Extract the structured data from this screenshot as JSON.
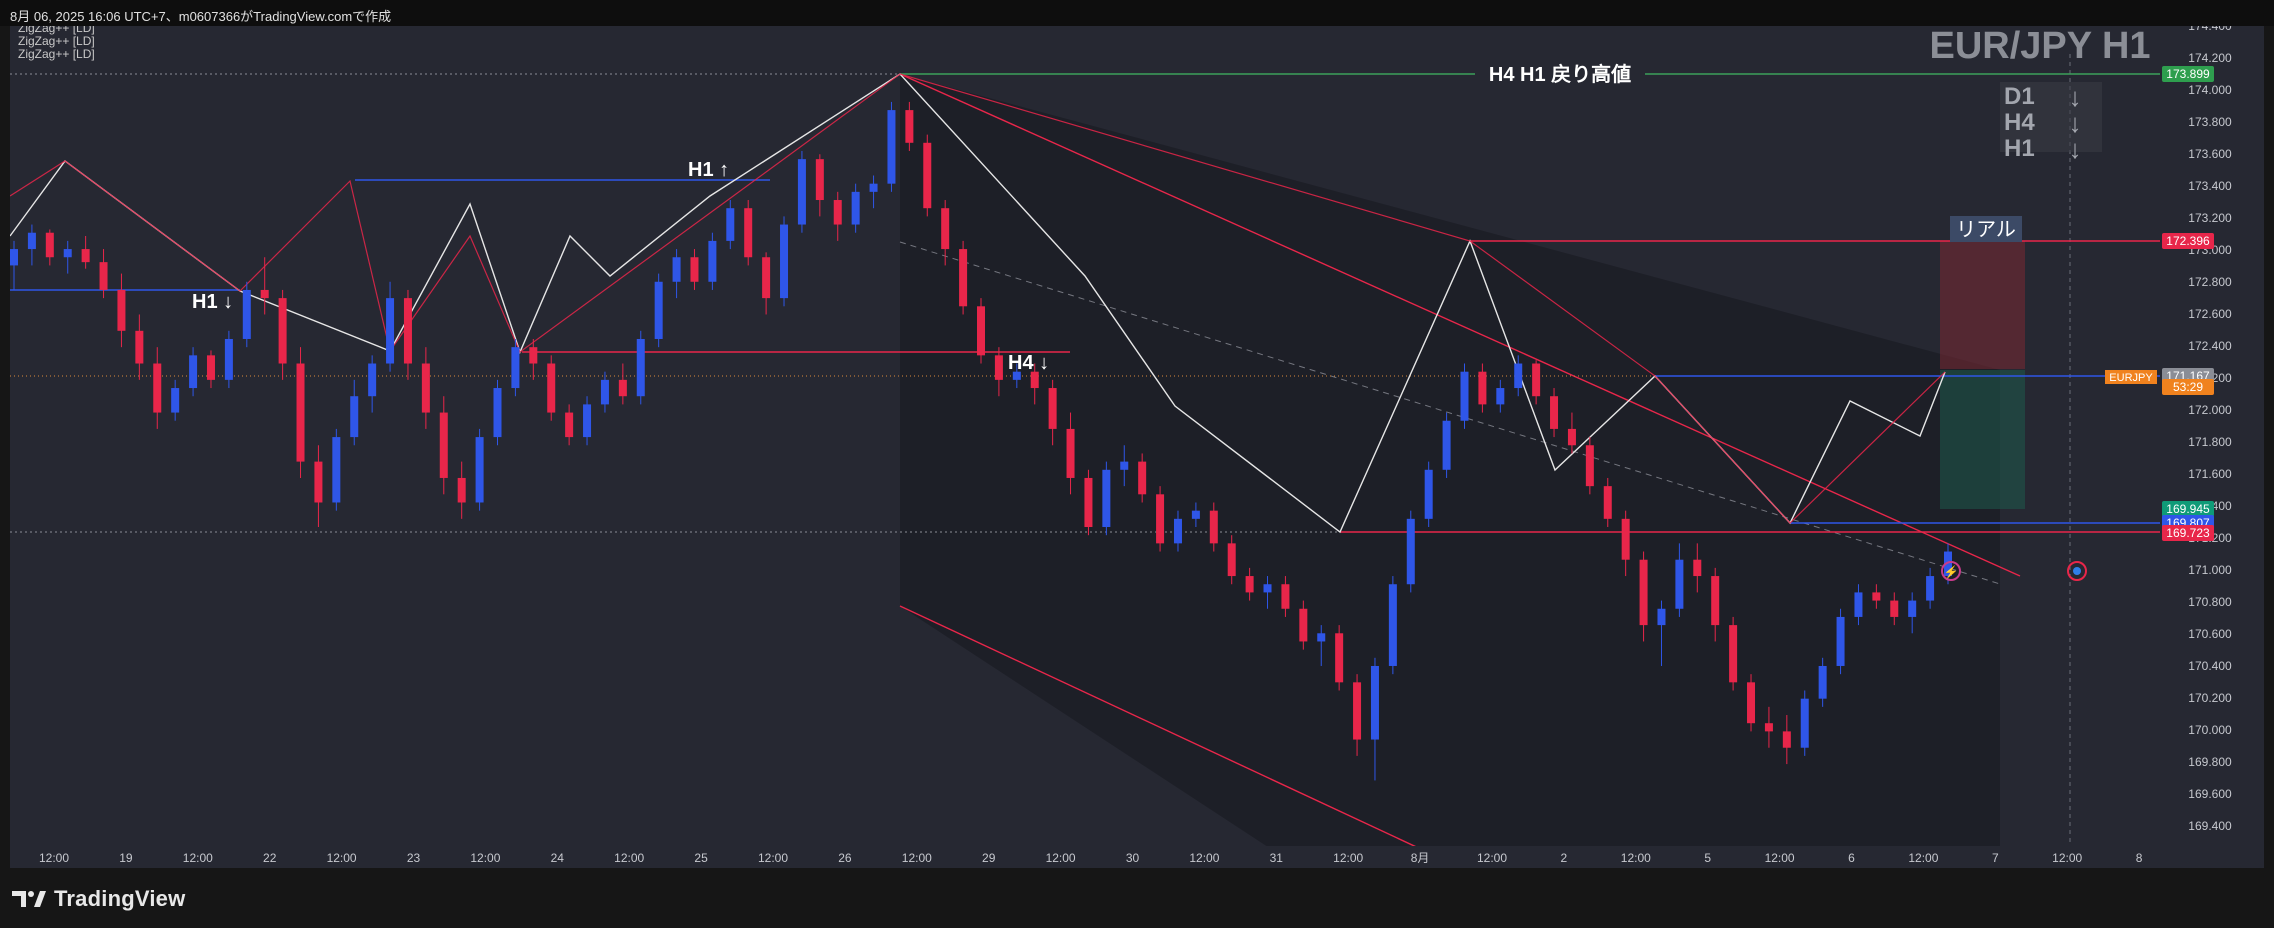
{
  "header": {
    "caption": "8月 06, 2025 16:06 UTC+7、m0607366がTradingView.comで作成"
  },
  "indicators": [
    "ZigZag++ [LD]",
    "ZigZag++ [LD]",
    "ZigZag++ [LD]"
  ],
  "watermark": {
    "title": "EUR/JPY H1"
  },
  "trend_panel": [
    {
      "tf": "D1",
      "arrow": "↓"
    },
    {
      "tf": "H4",
      "arrow": "↓"
    },
    {
      "tf": "H1",
      "arrow": "↓"
    }
  ],
  "annotations": {
    "resistance_label": "H4 H1 戻り高値",
    "real_label": "リアル",
    "h1_down": "H1 ↓",
    "h1_up": "H1 ↑",
    "h4_down": "H4 ↓"
  },
  "price_axis": {
    "ticks": [
      "174.400",
      "174.200",
      "174.000",
      "173.800",
      "173.600",
      "173.400",
      "173.200",
      "173.000",
      "172.800",
      "172.600",
      "172.400",
      "172.200",
      "172.000",
      "171.800",
      "171.600",
      "171.400",
      "171.200",
      "171.000",
      "170.800",
      "170.600",
      "170.400",
      "170.200",
      "170.000",
      "169.800",
      "169.600",
      "169.400"
    ],
    "badges": [
      {
        "text": "173.899",
        "color": "#2e9e4e"
      },
      {
        "text": "172.396",
        "color": "#e8264a"
      },
      {
        "text": "171.167",
        "color": "#8a8d96"
      },
      {
        "text": "53:29",
        "color": "#f0821e"
      },
      {
        "text": "169.945",
        "color": "#0f9b78"
      },
      {
        "text": "169.807",
        "color": "#2f56e8"
      },
      {
        "text": "169.723",
        "color": "#e8264a"
      }
    ],
    "symbol_badge": "EURJPY"
  },
  "time_axis": [
    "12:00",
    "19",
    "12:00",
    "22",
    "12:00",
    "23",
    "12:00",
    "24",
    "12:00",
    "25",
    "12:00",
    "26",
    "12:00",
    "29",
    "12:00",
    "30",
    "12:00",
    "31",
    "12:00",
    "8月",
    "12:00",
    "2",
    "12:00",
    "5",
    "12:00",
    "6",
    "12:00",
    "7",
    "12:00",
    "8"
  ],
  "colors": {
    "bull": "#2f56e8",
    "bear": "#e8264a",
    "background": "#262832",
    "channel": "#e8264a",
    "resistance": "#3ca05a",
    "zigzag": "#e6e6e6"
  },
  "brand": {
    "name": "TradingView"
  },
  "chart_data": {
    "type": "candlestick",
    "title": "EUR/JPY H1",
    "ylim": [
      169.3,
      174.45
    ],
    "current_price": 171.167,
    "levels": {
      "resistance": 173.899,
      "stop_loss": 172.396,
      "take_profit": 169.945,
      "support_1": 169.807,
      "support_2": 169.723
    },
    "candles": [
      [
        172.9,
        173.05,
        172.75,
        173.0
      ],
      [
        173.0,
        173.15,
        172.9,
        173.1
      ],
      [
        173.1,
        173.12,
        172.9,
        172.95
      ],
      [
        172.95,
        173.05,
        172.85,
        173.0
      ],
      [
        173.0,
        173.08,
        172.88,
        172.92
      ],
      [
        172.92,
        173.0,
        172.7,
        172.75
      ],
      [
        172.75,
        172.85,
        172.4,
        172.5
      ],
      [
        172.5,
        172.6,
        172.2,
        172.3
      ],
      [
        172.3,
        172.4,
        171.9,
        172.0
      ],
      [
        172.0,
        172.2,
        171.95,
        172.15
      ],
      [
        172.15,
        172.4,
        172.1,
        172.35
      ],
      [
        172.35,
        172.38,
        172.15,
        172.2
      ],
      [
        172.2,
        172.5,
        172.15,
        172.45
      ],
      [
        172.45,
        172.8,
        172.4,
        172.75
      ],
      [
        172.75,
        172.95,
        172.6,
        172.7
      ],
      [
        172.7,
        172.75,
        172.2,
        172.3
      ],
      [
        172.3,
        172.4,
        171.6,
        171.7
      ],
      [
        171.7,
        171.8,
        171.3,
        171.45
      ],
      [
        171.45,
        171.9,
        171.4,
        171.85
      ],
      [
        171.85,
        172.2,
        171.8,
        172.1
      ],
      [
        172.1,
        172.35,
        172.0,
        172.3
      ],
      [
        172.3,
        172.8,
        172.25,
        172.7
      ],
      [
        172.7,
        172.75,
        172.2,
        172.3
      ],
      [
        172.3,
        172.4,
        171.9,
        172.0
      ],
      [
        172.0,
        172.1,
        171.5,
        171.6
      ],
      [
        171.6,
        171.7,
        171.35,
        171.45
      ],
      [
        171.45,
        171.9,
        171.4,
        171.85
      ],
      [
        171.85,
        172.2,
        171.8,
        172.15
      ],
      [
        172.15,
        172.45,
        172.1,
        172.4
      ],
      [
        172.4,
        172.45,
        172.2,
        172.3
      ],
      [
        172.3,
        172.35,
        171.95,
        172.0
      ],
      [
        172.0,
        172.05,
        171.8,
        171.85
      ],
      [
        171.85,
        172.1,
        171.8,
        172.05
      ],
      [
        172.05,
        172.25,
        172.0,
        172.2
      ],
      [
        172.2,
        172.3,
        172.05,
        172.1
      ],
      [
        172.1,
        172.5,
        172.05,
        172.45
      ],
      [
        172.45,
        172.85,
        172.4,
        172.8
      ],
      [
        172.8,
        173.0,
        172.7,
        172.95
      ],
      [
        172.95,
        173.0,
        172.75,
        172.8
      ],
      [
        172.8,
        173.1,
        172.75,
        173.05
      ],
      [
        173.05,
        173.3,
        173.0,
        173.25
      ],
      [
        173.25,
        173.3,
        172.9,
        172.95
      ],
      [
        172.95,
        172.98,
        172.6,
        172.7
      ],
      [
        172.7,
        173.2,
        172.65,
        173.15
      ],
      [
        173.15,
        173.6,
        173.1,
        173.55
      ],
      [
        173.55,
        173.58,
        173.2,
        173.3
      ],
      [
        173.3,
        173.35,
        173.05,
        173.15
      ],
      [
        173.15,
        173.4,
        173.1,
        173.35
      ],
      [
        173.35,
        173.45,
        173.25,
        173.4
      ],
      [
        173.4,
        173.9,
        173.35,
        173.85
      ],
      [
        173.85,
        173.9,
        173.6,
        173.65
      ],
      [
        173.65,
        173.7,
        173.2,
        173.25
      ],
      [
        173.25,
        173.3,
        172.9,
        173.0
      ],
      [
        173.0,
        173.05,
        172.6,
        172.65
      ],
      [
        172.65,
        172.7,
        172.3,
        172.35
      ],
      [
        172.35,
        172.4,
        172.1,
        172.2
      ],
      [
        172.2,
        172.3,
        172.15,
        172.25
      ],
      [
        172.25,
        172.3,
        172.05,
        172.15
      ],
      [
        172.15,
        172.2,
        171.8,
        171.9
      ],
      [
        171.9,
        172.0,
        171.5,
        171.6
      ],
      [
        171.6,
        171.65,
        171.25,
        171.3
      ],
      [
        171.3,
        171.7,
        171.25,
        171.65
      ],
      [
        171.65,
        171.8,
        171.55,
        171.7
      ],
      [
        171.7,
        171.75,
        171.45,
        171.5
      ],
      [
        171.5,
        171.55,
        171.15,
        171.2
      ],
      [
        171.2,
        171.4,
        171.15,
        171.35
      ],
      [
        171.35,
        171.45,
        171.3,
        171.4
      ],
      [
        171.4,
        171.45,
        171.15,
        171.2
      ],
      [
        171.2,
        171.25,
        170.95,
        171.0
      ],
      [
        171.0,
        171.05,
        170.85,
        170.9
      ],
      [
        170.9,
        171.0,
        170.8,
        170.95
      ],
      [
        170.95,
        171.0,
        170.75,
        170.8
      ],
      [
        170.8,
        170.85,
        170.55,
        170.6
      ],
      [
        170.6,
        170.7,
        170.45,
        170.65
      ],
      [
        170.65,
        170.7,
        170.3,
        170.35
      ],
      [
        170.35,
        170.4,
        169.9,
        170.0
      ],
      [
        170.0,
        170.5,
        169.75,
        170.45
      ],
      [
        170.45,
        171.0,
        170.4,
        170.95
      ],
      [
        170.95,
        171.4,
        170.9,
        171.35
      ],
      [
        171.35,
        171.7,
        171.3,
        171.65
      ],
      [
        171.65,
        172.0,
        171.6,
        171.95
      ],
      [
        171.95,
        172.3,
        171.9,
        172.25
      ],
      [
        172.25,
        172.3,
        172.0,
        172.05
      ],
      [
        172.05,
        172.2,
        172.0,
        172.15
      ],
      [
        172.15,
        172.35,
        172.1,
        172.3
      ],
      [
        172.3,
        172.32,
        172.05,
        172.1
      ],
      [
        172.1,
        172.15,
        171.85,
        171.9
      ],
      [
        171.9,
        172.0,
        171.75,
        171.8
      ],
      [
        171.8,
        171.85,
        171.5,
        171.55
      ],
      [
        171.55,
        171.6,
        171.3,
        171.35
      ],
      [
        171.35,
        171.4,
        171.0,
        171.1
      ],
      [
        171.1,
        171.15,
        170.6,
        170.7
      ],
      [
        170.7,
        170.85,
        170.45,
        170.8
      ],
      [
        170.8,
        171.2,
        170.75,
        171.1
      ],
      [
        171.1,
        171.2,
        170.9,
        171.0
      ],
      [
        171.0,
        171.05,
        170.6,
        170.7
      ],
      [
        170.7,
        170.75,
        170.3,
        170.35
      ],
      [
        170.35,
        170.4,
        170.05,
        170.1
      ],
      [
        170.1,
        170.2,
        169.95,
        170.05
      ],
      [
        170.05,
        170.15,
        169.85,
        169.95
      ],
      [
        169.95,
        170.3,
        169.9,
        170.25
      ],
      [
        170.25,
        170.5,
        170.2,
        170.45
      ],
      [
        170.45,
        170.8,
        170.4,
        170.75
      ],
      [
        170.75,
        170.95,
        170.7,
        170.9
      ],
      [
        170.9,
        170.95,
        170.8,
        170.85
      ],
      [
        170.85,
        170.9,
        170.7,
        170.75
      ],
      [
        170.75,
        170.9,
        170.65,
        170.85
      ],
      [
        170.85,
        171.05,
        170.8,
        171.0
      ],
      [
        171.0,
        171.2,
        170.95,
        171.15
      ]
    ]
  }
}
